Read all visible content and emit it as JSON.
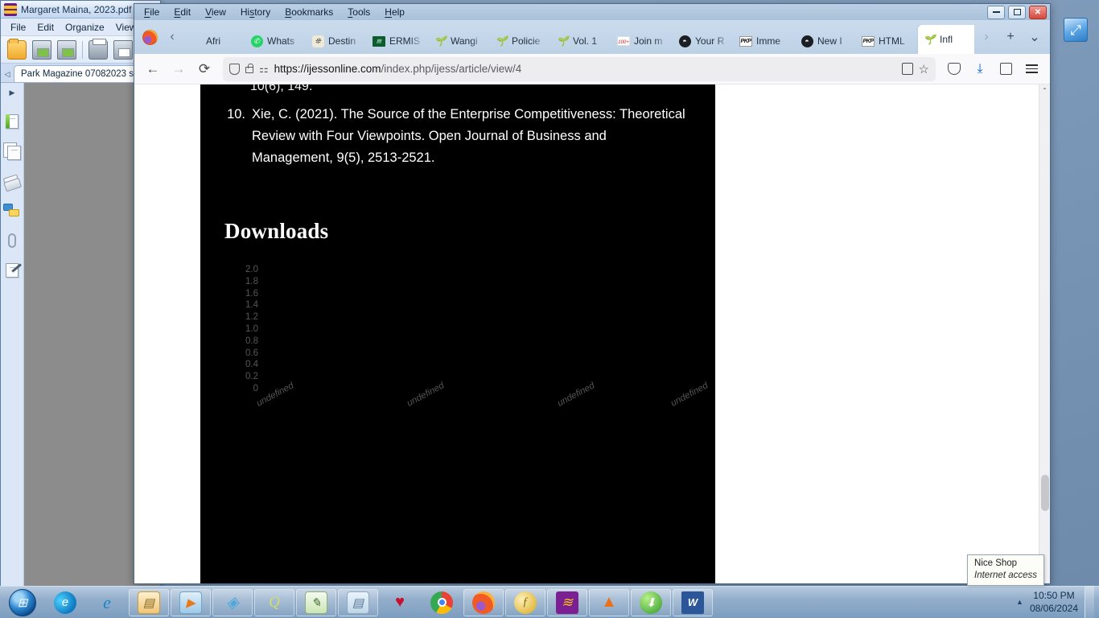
{
  "desktop": {
    "icon_name": "resize-shortcut-icon",
    "icon_glyph": "⤢"
  },
  "pdf_app": {
    "title": "Margaret Maina, 2023.pdf",
    "logo_name": "pdf-xchange-logo",
    "menu": [
      "File",
      "Edit",
      "Organize",
      "View"
    ],
    "toolbar_icons": [
      "open-folder-icon",
      "save-icon",
      "save-as-icon",
      "print-icon",
      "layout-icon"
    ],
    "tab_label": "Park Magazine 07082023 s",
    "rail_icons": [
      "expand-caret-icon",
      "bookmarks-icon",
      "pages-icon",
      "layers-icon",
      "comments-icon",
      "attachments-icon",
      "signature-icon"
    ]
  },
  "firefox": {
    "menubar": [
      {
        "pre": "",
        "accel": "F",
        "post": "ile"
      },
      {
        "pre": "",
        "accel": "E",
        "post": "dit"
      },
      {
        "pre": "",
        "accel": "V",
        "post": "iew"
      },
      {
        "pre": "Hi",
        "accel": "s",
        "post": "tory"
      },
      {
        "pre": "",
        "accel": "B",
        "post": "ookmarks"
      },
      {
        "pre": "",
        "accel": "T",
        "post": "ools"
      },
      {
        "pre": "",
        "accel": "H",
        "post": "elp"
      }
    ],
    "window_controls": {
      "minimize": "minimize-button",
      "maximize": "maximize-button",
      "close": "✕"
    },
    "tabs": [
      {
        "label": "Afri",
        "icon": "none",
        "active": false
      },
      {
        "label": "Whats",
        "icon": "whatsapp",
        "active": false
      },
      {
        "label": "Destin",
        "icon": "paw",
        "active": false
      },
      {
        "label": "ERMIS",
        "icon": "ermis",
        "active": false
      },
      {
        "label": "Wangi",
        "icon": "plant",
        "active": false
      },
      {
        "label": "Policie",
        "icon": "plant",
        "active": false
      },
      {
        "label": "Vol. 1",
        "icon": "plant",
        "active": false
      },
      {
        "label": "Join m",
        "icon": "gmail",
        "active": false
      },
      {
        "label": "Your R",
        "icon": "github",
        "active": false
      },
      {
        "label": "Imme",
        "icon": "pkp",
        "active": false
      },
      {
        "label": "New I",
        "icon": "github",
        "active": false
      },
      {
        "label": "HTML",
        "icon": "pkp",
        "active": false
      },
      {
        "label": "Infl",
        "icon": "plant",
        "active": true
      }
    ],
    "tab_controls": {
      "scroll_left": "‹",
      "scroll_right": "›",
      "new_tab": "+",
      "list_all_tabs": "⌄"
    },
    "navbar": {
      "back": "←",
      "forward": "→",
      "reload": "⟳",
      "url_host": "https://ijessonline.com",
      "url_path": "/index.php/ijess/article/view/4",
      "url_full": "https://ijessonline.com/index.php/ijess/article/view/4",
      "reader_icon": "reader-view-icon",
      "bookmark_icon": "☆",
      "pocket_icon": "pocket-icon",
      "downloads_icon": "downloads-icon",
      "extensions_icon": "extensions-icon",
      "menu_icon": "app-menu-icon"
    },
    "scrollbar": {
      "up_arrow": "⌃",
      "down_arrow": "⌄"
    }
  },
  "page": {
    "cut_reference": "10(6), 149.",
    "references": [
      {
        "number": "10.",
        "text": "Xie, C. (2021). The Source of the Enterprise Competitiveness: Theoretical Review with Four Viewpoints. Open Journal of Business and Management, 9(5), 2513-2521."
      }
    ],
    "downloads_heading": "Downloads"
  },
  "chart_data": {
    "type": "bar",
    "title": "Downloads",
    "categories": [
      "undefined",
      "undefined",
      "undefined",
      "undefined"
    ],
    "values": [
      0,
      0,
      0,
      0
    ],
    "series": [
      {
        "name": "Downloads",
        "values": [
          0,
          0,
          0,
          0
        ]
      }
    ],
    "ytick_labels": [
      "2.0",
      "1.8",
      "1.6",
      "1.4",
      "1.2",
      "1.0",
      "0.8",
      "0.6",
      "0.4",
      "0.2",
      "0"
    ],
    "ylim": [
      0,
      2
    ],
    "xlabel": "",
    "ylabel": "",
    "grid": false,
    "legend": "none",
    "background_color": "#000000",
    "tick_color": "#565656"
  },
  "taskbar": {
    "start_label": "start-button",
    "items": [
      {
        "name": "edge",
        "glyph": "e",
        "bg": "#1e7fc4",
        "pinned": false
      },
      {
        "name": "internet-explorer",
        "glyph": "e",
        "bg": "#e8f3fb",
        "pinned": false
      },
      {
        "name": "file-explorer",
        "glyph": "🗂",
        "bg": "#f3d79a",
        "pinned": true
      },
      {
        "name": "media-player",
        "glyph": "▶",
        "bg": "#d6e9f7",
        "pinned": true
      },
      {
        "name": "foxit-reader",
        "glyph": "◆",
        "bg": "#cfe7f5",
        "pinned": true
      },
      {
        "name": "quark",
        "glyph": "Q",
        "bg": "#eef6e2",
        "pinned": true
      },
      {
        "name": "notepad-plus-plus",
        "glyph": "✎",
        "bg": "#e9f5df",
        "pinned": true
      },
      {
        "name": "notepad",
        "glyph": "▤",
        "bg": "#dfeaf5",
        "pinned": true
      },
      {
        "name": "solitaire",
        "glyph": "♥",
        "bg": "#f6e7e7",
        "pinned": false
      },
      {
        "name": "chrome",
        "glyph": "◉",
        "bg": "#ffffff",
        "pinned": false
      },
      {
        "name": "firefox",
        "glyph": "🦊",
        "bg": "#ffe9d6",
        "pinned": true
      },
      {
        "name": "foxit-phantom",
        "glyph": "ƒ",
        "bg": "#f5d87a",
        "pinned": true
      },
      {
        "name": "pdf-xchange",
        "glyph": "≋",
        "bg": "#7b1f93",
        "pinned": true
      },
      {
        "name": "vlc",
        "glyph": "▲",
        "bg": "#ffe4c4",
        "pinned": true
      },
      {
        "name": "nitro-pdf",
        "glyph": "⬇",
        "bg": "#bfe5a8",
        "pinned": true
      },
      {
        "name": "word",
        "glyph": "W",
        "bg": "#2b579a",
        "pinned": true
      }
    ],
    "tray": {
      "caret": "▲",
      "time": "10:50 PM",
      "date": "08/06/2024"
    },
    "tooltip": {
      "title": "Nice Shop",
      "subtitle": "Internet access"
    }
  }
}
